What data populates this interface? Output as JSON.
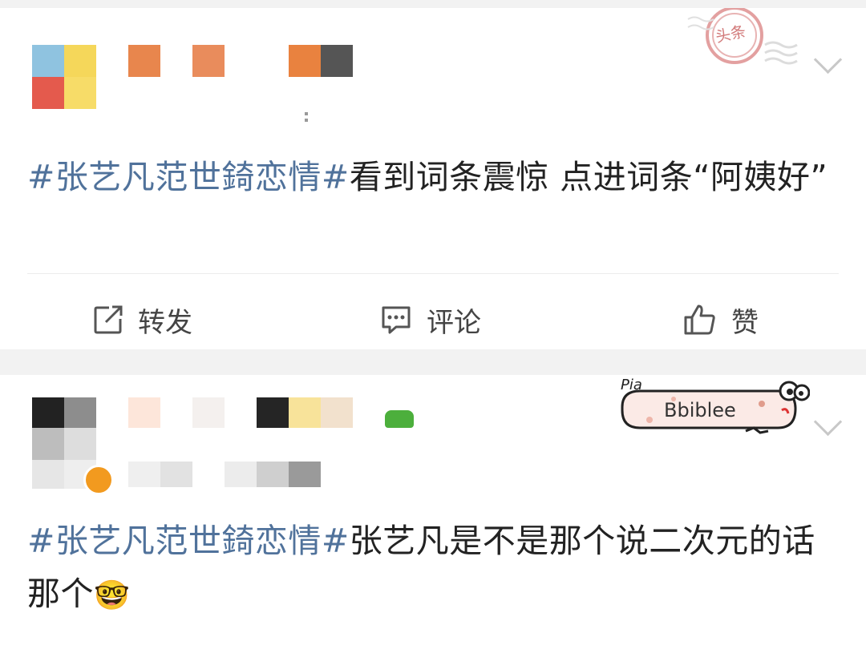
{
  "post1": {
    "hashtag": "#张艺凡范世錡恋情#",
    "text": "看到词条震惊 点进词条“阿姨好”",
    "stamp_label": "头条",
    "actions": {
      "repost": "转发",
      "comment": "评论",
      "like": "赞"
    }
  },
  "post2": {
    "hashtag": "#张艺凡范世錡恋情#",
    "text": "张艺凡是不是那个说二次元的话那个",
    "emoji": "🤓",
    "badge_text": "Bbiblee",
    "badge_pia": "Pia"
  },
  "colors": {
    "hashtag": "#50729b",
    "text": "#222222",
    "background": "#f2f2f2"
  }
}
